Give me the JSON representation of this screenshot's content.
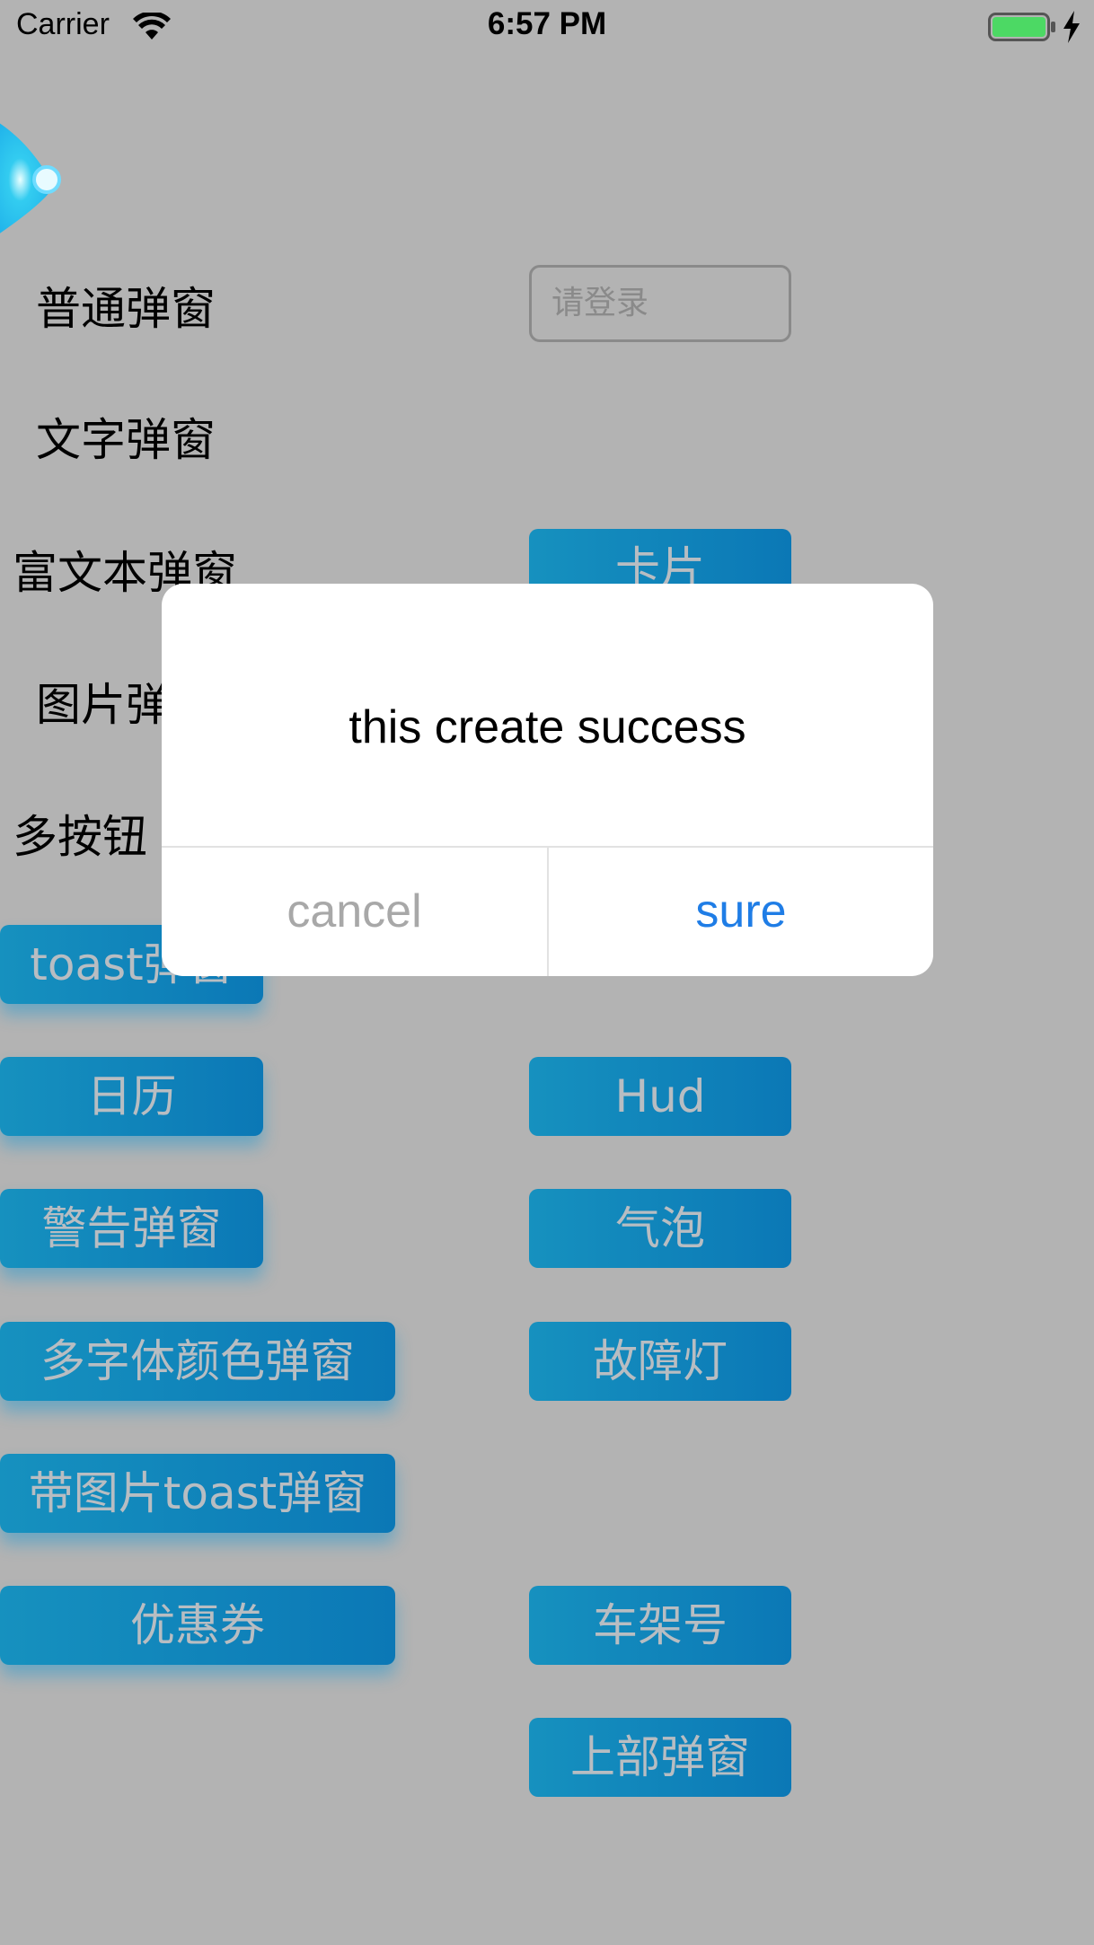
{
  "status_bar": {
    "carrier": "Carrier",
    "time": "6:57 PM",
    "battery_color": "#4cd964"
  },
  "labels": {
    "normal_popup": "普通弹窗",
    "text_popup": "文字弹窗",
    "rich_text_popup": "富文本弹窗",
    "image_popup": "图片弹",
    "multi_button_popup": "多按钮"
  },
  "login_input": {
    "placeholder": "请登录"
  },
  "buttons": {
    "card": "卡片",
    "toast_popup": "toast弹窗",
    "calendar": "日历",
    "hud": "Hud",
    "warning_popup": "警告弹窗",
    "bubble": "气泡",
    "multi_font_color_popup": "多字体颜色弹窗",
    "fault_light": "故障灯",
    "image_toast_popup": "带图片toast弹窗",
    "coupon": "优惠券",
    "vin": "车架号",
    "top_popup": "上部弹窗"
  },
  "alert": {
    "message": "this create success",
    "cancel_label": "cancel",
    "sure_label": "sure",
    "sure_color": "#1f7de6"
  },
  "colors": {
    "overlay_background": "#b3b3b3",
    "button_gradient_start": "#1691bf",
    "button_gradient_end": "#0b78b6"
  }
}
